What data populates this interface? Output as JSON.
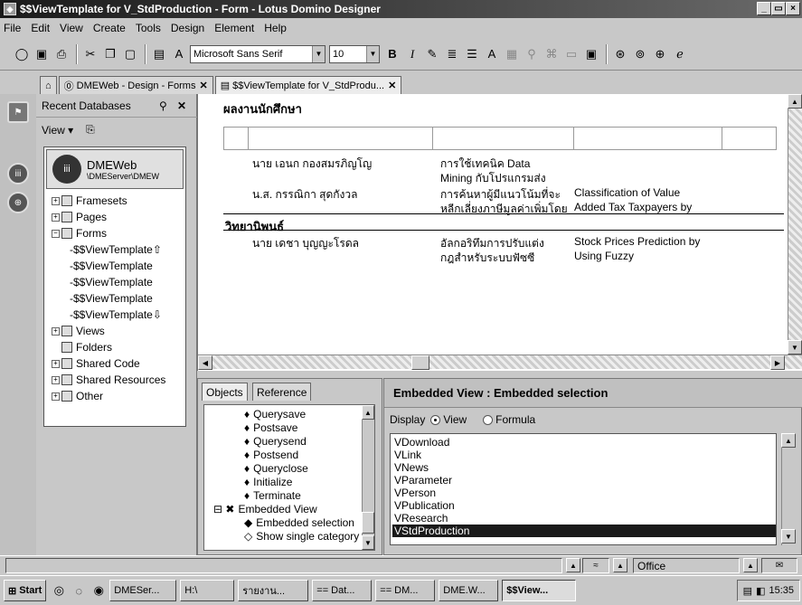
{
  "window": {
    "title": "$$ViewTemplate for V_StdProduction - Form - Lotus Domino Designer",
    "buttons": [
      "_",
      "×"
    ]
  },
  "menu": [
    "File",
    "Edit",
    "View",
    "Create",
    "Tools",
    "Design",
    "Element",
    "Help"
  ],
  "toolbar": {
    "font_name": "Microsoft Sans Serif",
    "font_size": "10",
    "bold": "B",
    "italic": "I"
  },
  "tabs": [
    {
      "label": "DMEWeb - Design - Forms"
    },
    {
      "label": "$$ViewTemplate for V_StdProdu..."
    }
  ],
  "bookmarks": {
    "header": "Recent Databases",
    "view_menu": "View ▾",
    "database": {
      "name": "DMEWeb",
      "path": "\\DMEServer\\DMEW"
    },
    "tree": [
      {
        "label": "Framesets",
        "expander": "+"
      },
      {
        "label": "Pages",
        "expander": "+"
      },
      {
        "label": "Forms",
        "expander": "−"
      },
      {
        "label": "$$ViewTemplate"
      },
      {
        "label": "$$ViewTemplate"
      },
      {
        "label": "$$ViewTemplate"
      },
      {
        "label": "$$ViewTemplate"
      },
      {
        "label": "$$ViewTemplate"
      },
      {
        "label": "Views",
        "expander": "+"
      },
      {
        "label": "Folders"
      },
      {
        "label": "Shared Code",
        "expander": "+"
      },
      {
        "label": "Shared Resources",
        "expander": "+"
      },
      {
        "label": "Other",
        "expander": "+"
      }
    ]
  },
  "editor": {
    "heading": "ผลงานนักศึกษา",
    "rows": [
      {
        "author": "นาย เอนก กองสมรภิญโญ",
        "title_th_1": "การใช้เทคนิค Data",
        "title_th_2": "Mining กับโปรแกรมส่ง",
        "title_en_1": "",
        "title_en_2": ""
      },
      {
        "author": "น.ส. กรรณิกา สุดกังวล",
        "title_th_1": "การค้นหาผู้มีแนวโน้มที่จะ",
        "title_th_2": "หลีกเลี่ยงภาษีมูลค่าเพิ่มโดย",
        "title_en_1": "Classification of Value",
        "title_en_2": "Added Tax Taxpayers by"
      },
      {
        "section": "วิทยานิพนธ์"
      },
      {
        "author": "นาย เดชา บุญญะโรดล",
        "title_th_1": "อัลกอริทึมการปรับแต่ง",
        "title_th_2": "กฎสำหรับระบบฟัซซี",
        "title_en_1": "Stock Prices Prediction by",
        "title_en_2": "Using Fuzzy"
      }
    ]
  },
  "objects_panel": {
    "tabs": [
      "Objects",
      "Reference"
    ],
    "items": [
      {
        "label": "Querysave",
        "mark": "♦"
      },
      {
        "label": "Postsave",
        "mark": "♦"
      },
      {
        "label": "Querysend",
        "mark": "♦"
      },
      {
        "label": "Postsend",
        "mark": "♦"
      },
      {
        "label": "Queryclose",
        "mark": "♦"
      },
      {
        "label": "Initialize",
        "mark": "♦"
      },
      {
        "label": "Terminate",
        "mark": "♦"
      },
      {
        "label": "Embedded View",
        "mark": "⊟ ✖"
      },
      {
        "label": "Embedded selection",
        "mark": "◆"
      },
      {
        "label": "Show single category",
        "mark": "◇"
      }
    ]
  },
  "embedded_panel": {
    "header": "Embedded View : Embedded selection",
    "display_label": "Display",
    "options": [
      {
        "label": "View",
        "selected": true
      },
      {
        "label": "Formula",
        "selected": false
      }
    ],
    "views": [
      "VDownload",
      "VLink",
      "VNews",
      "VParameter",
      "VPerson",
      "VPublication",
      "VResearch",
      "VStdProduction"
    ],
    "selected_view": "VStdProduction"
  },
  "status": {
    "office": "Office"
  },
  "taskbar": {
    "start": "Start",
    "buttons": [
      "DMESer...",
      "H:\\",
      "รายงาน...",
      "== Dat...",
      "== DM...",
      "DME.W...",
      "$$View..."
    ],
    "active": "$$View...",
    "time": "15:35"
  }
}
